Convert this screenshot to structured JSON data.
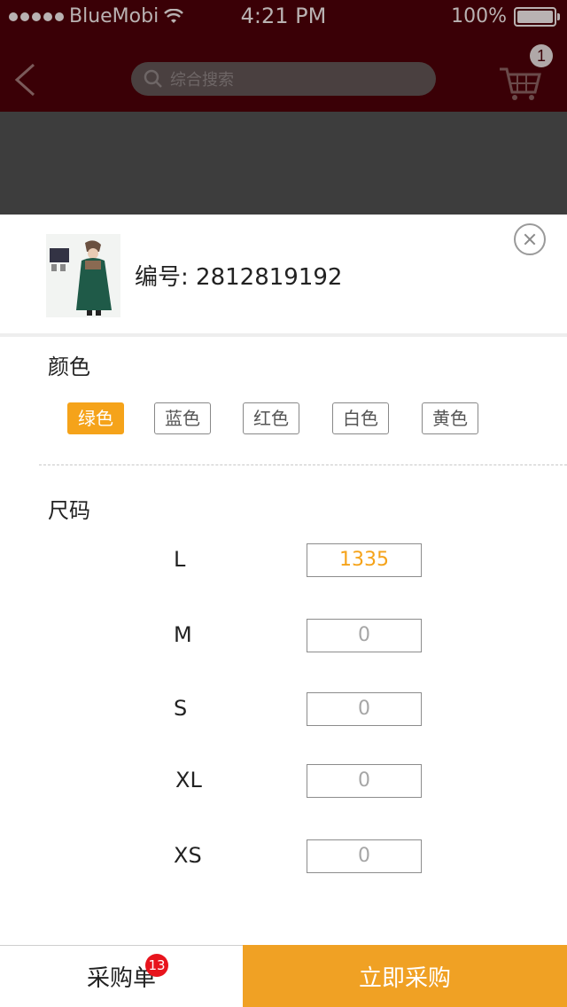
{
  "status_bar": {
    "carrier": "BlueMobi",
    "time": "4:21 PM",
    "battery": "100%"
  },
  "nav": {
    "search_placeholder": "综合搜索",
    "cart_count": "1",
    "icons": {
      "back": "chevron-left-icon",
      "search": "search-icon",
      "cart": "cart-icon"
    }
  },
  "product": {
    "code_label": "编号:",
    "code_value": "2812819192"
  },
  "color_section": {
    "title": "颜色",
    "options": [
      "绿色",
      "蓝色",
      "红色",
      "白色",
      "黄色"
    ],
    "selected": "绿色"
  },
  "size_section": {
    "title": "尺码",
    "rows": [
      {
        "size": "L",
        "qty": "1335"
      },
      {
        "size": "M",
        "qty": "0"
      },
      {
        "size": "S",
        "qty": "0"
      },
      {
        "size": "XL",
        "qty": "0"
      },
      {
        "size": "XS",
        "qty": "0"
      }
    ]
  },
  "bottom_bar": {
    "order_label": "采购单",
    "order_count": "13",
    "buy_label": "立即采购"
  },
  "colors": {
    "accent": "#f5a31a",
    "buy_button": "#f0a124",
    "badge": "#e8141d",
    "nav_bg": "#3a0006"
  }
}
